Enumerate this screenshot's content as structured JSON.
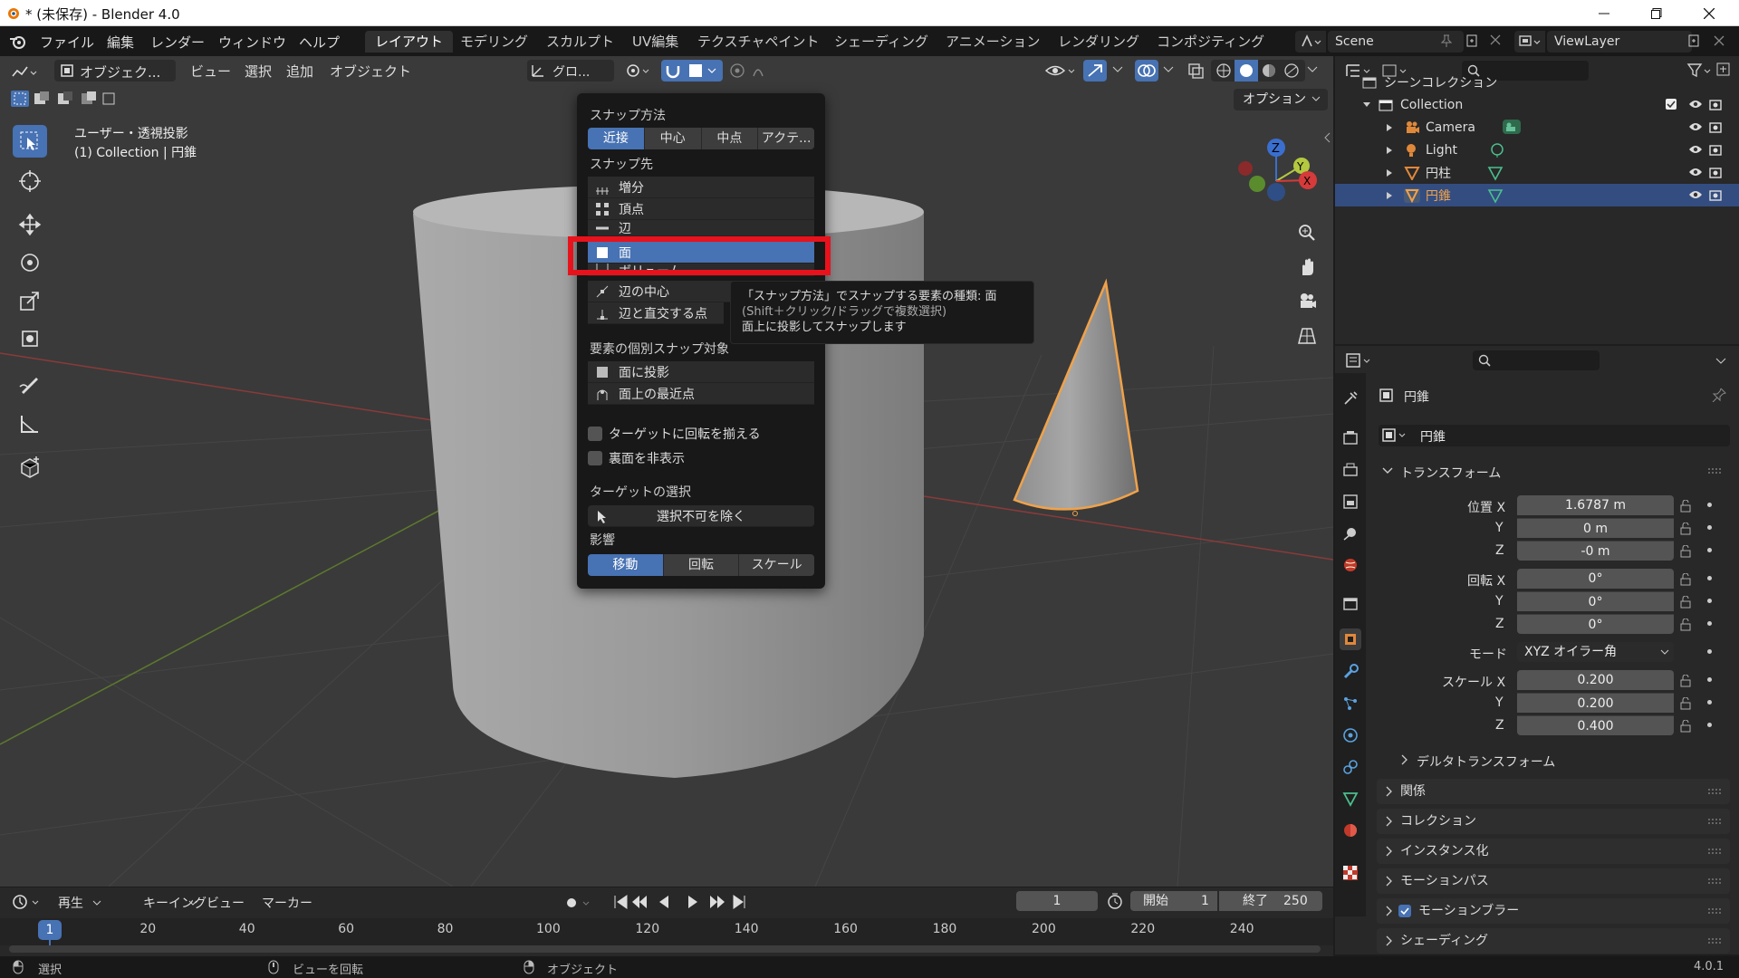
{
  "window": {
    "title": "* (未保存) - Blender 4.0"
  },
  "menubar": {
    "items": [
      "ファイル",
      "編集",
      "レンダー",
      "ウィンドウ",
      "ヘルプ"
    ],
    "workspaces": [
      "レイアウト",
      "モデリング",
      "スカルプト",
      "UV編集",
      "テクスチャペイント",
      "シェーディング",
      "アニメーション",
      "レンダリング",
      "コンポジティング"
    ],
    "active_workspace": "レイアウト",
    "scene": "Scene",
    "view_layer": "ViewLayer"
  },
  "viewport_header": {
    "mode": "オブジェク...",
    "menus": [
      "ビュー",
      "選択",
      "追加",
      "オブジェクト"
    ],
    "transform_orientation": "グロ...",
    "options_label": "オプション"
  },
  "viewport": {
    "view_name": "ユーザー・透視投影",
    "collection_info": "(1) Collection | 円錐"
  },
  "snap_popover": {
    "snap_method_label": "スナップ方法",
    "snap_methods": [
      "近接",
      "中心",
      "中点",
      "アクテ..."
    ],
    "snap_method_active": "近接",
    "snap_target_label": "スナップ先",
    "snap_targets": [
      {
        "label": "増分",
        "active": false
      },
      {
        "label": "頂点",
        "active": false
      },
      {
        "label": "辺",
        "active": false
      },
      {
        "label": "面",
        "active": true
      },
      {
        "label": "ボリューム",
        "active": false
      },
      {
        "label": "辺の中心",
        "active": false
      },
      {
        "label": "辺と直交する点",
        "active": false
      }
    ],
    "individual_label": "要素の個別スナップ対象",
    "individual_items": [
      "面に投影",
      "面上の最近点"
    ],
    "check_align_rotation": "ターゲットに回転を揃える",
    "check_backface": "裏面を非表示",
    "target_selection_label": "ターゲットの選択",
    "target_selection_value": "選択不可を除く",
    "affect_label": "影響",
    "affect_items": [
      "移動",
      "回転",
      "スケール"
    ],
    "affect_active": "移動"
  },
  "tooltip": {
    "line1": "「スナップ方法」でスナップする要素の種類: 面",
    "line2": "(Shift＋クリック/ドラッグで複数選択)",
    "line3": "面上に投影してスナップします"
  },
  "outliner": {
    "scene_collection": "シーンコレクション",
    "collection": "Collection",
    "objects": [
      {
        "name": "Camera",
        "selected": false
      },
      {
        "name": "Light",
        "selected": false
      },
      {
        "name": "円柱",
        "selected": false
      },
      {
        "name": "円錐",
        "selected": true
      }
    ]
  },
  "properties": {
    "object_name": "円錐",
    "object_field": "円錐",
    "transform_label": "トランスフォーム",
    "location_label": "位置 X",
    "location": [
      "1.6787 m",
      "0 m",
      "-0 m"
    ],
    "rotation_label": "回転 X",
    "rotation": [
      "0°",
      "0°",
      "0°"
    ],
    "mode_label": "モード",
    "mode_value": "XYZ オイラー角",
    "scale_label": "スケール X",
    "scale": [
      "0.200",
      "0.200",
      "0.400"
    ],
    "axis_y": "Y",
    "axis_z": "Z",
    "delta_transform": "デルタトランスフォーム",
    "panels": [
      "関係",
      "コレクション",
      "インスタンス化",
      "モーションパス",
      "モーションブラー",
      "シェーディング"
    ]
  },
  "timeline": {
    "menus": [
      "再生",
      "キーイング",
      "ビュー",
      "マーカー"
    ],
    "current_frame": "1",
    "start_label": "開始",
    "start": "1",
    "end_label": "終了",
    "end": "250",
    "ticks": [
      "20",
      "40",
      "60",
      "80",
      "100",
      "120",
      "140",
      "160",
      "180",
      "200",
      "220",
      "240"
    ],
    "playhead": "1"
  },
  "statusbar": {
    "select": "選択",
    "rotate_view": "ビューを回転",
    "object": "オブジェクト",
    "version": "4.0.1"
  },
  "colors": {
    "accent": "#4772b3",
    "highlight_box": "#e8121c",
    "selected_object": "#f0a24a"
  }
}
